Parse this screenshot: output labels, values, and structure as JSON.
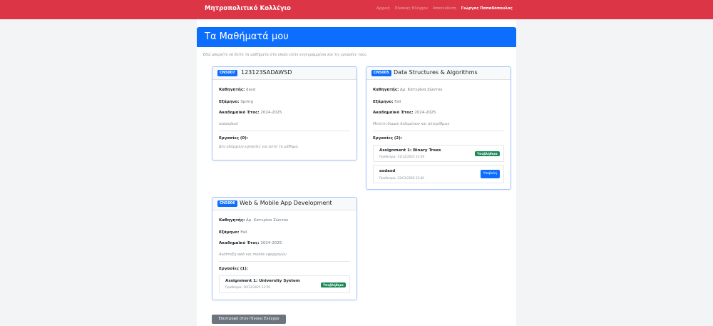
{
  "navbar": {
    "brand": "Μητροπολιτικό Κολλέγιο",
    "links": [
      "Αρχική",
      "Πίνακας Ελέγχου",
      "Αποσύνδεση"
    ],
    "user": "Γιώργος Παπαδόπουλος"
  },
  "page": {
    "title": "Τα Μαθήματά μου",
    "intro": "Εδώ μπορείτε να δείτε τα μαθήματα στα οποία είστε εγγεγραμμένοι και τις εργασίες τους."
  },
  "labels": {
    "instructor": "Καθηγητής:",
    "semester": "Εξάμηνο:",
    "academic_year": "Ακαδημαϊκό Έτος:"
  },
  "courses": [
    {
      "code": "CN5007",
      "title": "123123SADAWSD",
      "instructor": "dasd",
      "semester": "Spring",
      "academic_year": "2024-2025",
      "description": "asdasdasd",
      "assignments_label": "Εργασίες (0):",
      "no_assignments": "Δεν υπάρχουν εργασίες για αυτό το μάθημα."
    },
    {
      "code": "CN5005",
      "title": "Data Structures & Algorithms",
      "instructor": "Δρ. Κατερίνα Ζώντου",
      "semester": "Fall",
      "academic_year": "2024-2025",
      "description": "Μελέτη δομών δεδομένων και αλγορίθμων",
      "assignments_label": "Εργασίες (2):",
      "assignments": [
        {
          "title": "Assignment 1: Binary Trees",
          "due": "Προθεσμία: 31/12/2025 23:59",
          "status": "Υποβλήθηκε"
        },
        {
          "title": "asdasd",
          "due": "Προθεσμία: 22/01/2026 22:00",
          "action": "Υποβολή"
        }
      ]
    },
    {
      "code": "CN5006",
      "title": "Web & Mobile App Development",
      "instructor": "Δρ. Κατερίνα Ζώντου",
      "semester": "Fall",
      "academic_year": "2024-2025",
      "description": "Ανάπτυξη web και mobile εφαρμογών",
      "assignments_label": "Εργασίες (1):",
      "assignments": [
        {
          "title": "Assignment 1: University System",
          "due": "Προθεσμία: 30/12/2025 23:59",
          "status": "Υποβλήθηκε"
        }
      ]
    }
  ],
  "footer": {
    "back_button": "Επιστροφή στον Πίνακα Ελέγχου"
  },
  "colors": {
    "navbar": "#dc3545",
    "primary": "#0d6efd",
    "success": "#198754",
    "secondary": "#6c757d"
  }
}
